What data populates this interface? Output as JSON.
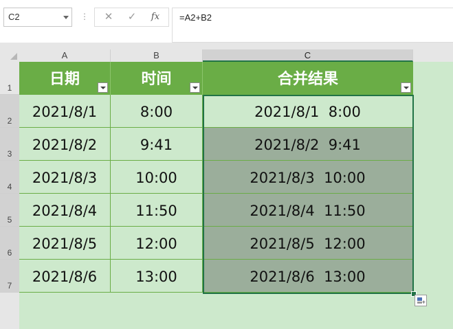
{
  "formula_bar": {
    "name_box": "C2",
    "cancel_icon": "✕",
    "enter_icon": "✓",
    "fx_label": "fx",
    "formula": "=A2+B2"
  },
  "columns": [
    "A",
    "B",
    "C"
  ],
  "active_column": "C",
  "rows": [
    "1",
    "2",
    "3",
    "4",
    "5",
    "6",
    "7"
  ],
  "active_rows": [
    "2",
    "3",
    "4",
    "5",
    "6",
    "7"
  ],
  "table": {
    "headers": [
      "日期",
      "时间",
      "合并结果"
    ],
    "rows": [
      [
        "2021/8/1",
        "8:00",
        "2021/8/1  8:00"
      ],
      [
        "2021/8/2",
        "9:41",
        "2021/8/2  9:41"
      ],
      [
        "2021/8/3",
        "10:00",
        "2021/8/3  10:00"
      ],
      [
        "2021/8/4",
        "11:50",
        "2021/8/4  11:50"
      ],
      [
        "2021/8/5",
        "12:00",
        "2021/8/5  12:00"
      ],
      [
        "2021/8/6",
        "13:00",
        "2021/8/6  13:00"
      ]
    ]
  },
  "icons": {
    "name_box_dropdown": "chevron-down-icon",
    "cancel": "close-icon",
    "enter": "check-icon",
    "function": "fx-icon",
    "filter": "filter-dropdown-icon",
    "quick_analysis": "quick-analysis-icon"
  },
  "colors": {
    "header_fill": "#6aad46",
    "band_fill": "#cde9cc",
    "selection_fill": "#9bae9b",
    "selection_border": "#217346"
  }
}
